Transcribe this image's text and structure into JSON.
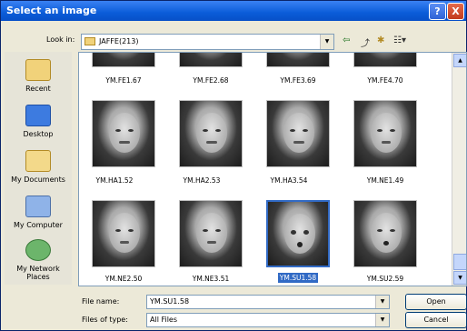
{
  "title": "Select an image",
  "title_buttons": {
    "help": "?",
    "close": "X"
  },
  "lookin": {
    "label": "Look in:",
    "value": "JAFFE(213)"
  },
  "toolbar": {
    "back": "⇦",
    "up": "⤴",
    "newfolder": "✱",
    "views": "☷▾"
  },
  "places": [
    {
      "label": "Recent",
      "icon": "recent-folder-icon"
    },
    {
      "label": "Desktop",
      "icon": "desktop-icon"
    },
    {
      "label": "My Documents",
      "icon": "my-documents-icon"
    },
    {
      "label": "My Computer",
      "icon": "my-computer-icon"
    },
    {
      "label": "My Network Places",
      "icon": "network-places-icon"
    }
  ],
  "files_row1": [
    "YM.FE1.67",
    "YM.FE2.68",
    "YM.FE3.69",
    "YM.FE4.70"
  ],
  "files_row2": [
    "YM.HA1.52",
    "YM.HA2.53",
    "YM.HA3.54",
    "YM.NE1.49"
  ],
  "files_row3": [
    "YM.NE2.50",
    "YM.NE3.51",
    "YM.SU1.58",
    "YM.SU2.59"
  ],
  "selected_file": "YM.SU1.58",
  "filename": {
    "label": "File name:",
    "value": "YM.SU1.58"
  },
  "filetype": {
    "label": "Files of type:",
    "value": "All Files"
  },
  "buttons": {
    "open": "Open",
    "cancel": "Cancel"
  },
  "colors": {
    "titlebar": "#0a5cd8",
    "selection": "#316ac5",
    "dialog": "#ece9d8"
  }
}
